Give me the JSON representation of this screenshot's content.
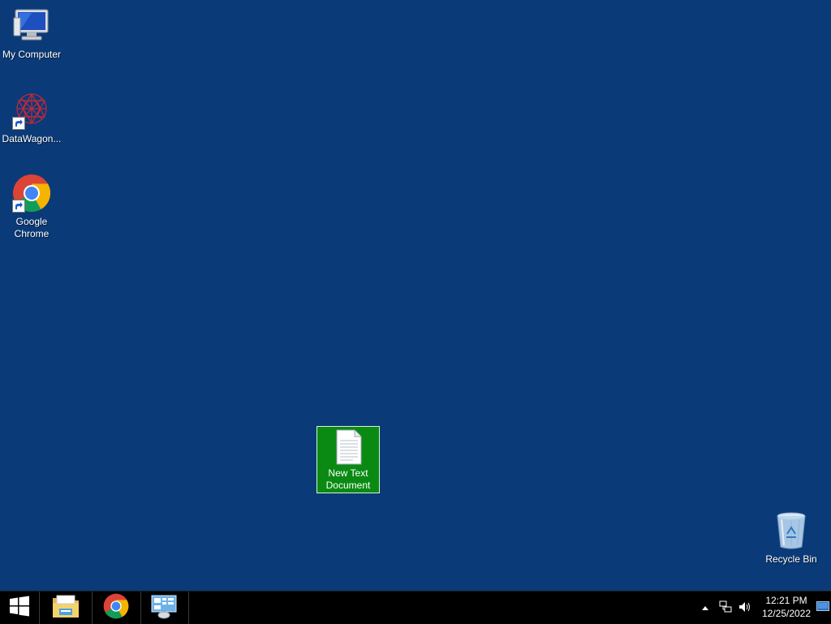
{
  "desktop": {
    "icons": [
      {
        "label": "My Computer",
        "icon": "my-computer-icon"
      },
      {
        "label": "DataWagon...",
        "icon": "datawagon-icon"
      },
      {
        "label": "Google Chrome",
        "line1": "Google",
        "line2": "Chrome",
        "icon": "chrome-icon"
      },
      {
        "label": "New Text Document",
        "line1": "New Text",
        "line2": "Document",
        "icon": "text-document-icon",
        "selected": true
      },
      {
        "label": "Recycle Bin",
        "icon": "recycle-bin-icon"
      }
    ]
  },
  "taskbar": {
    "start": {
      "icon": "windows-start-icon"
    },
    "pinned": [
      {
        "icon": "file-explorer-icon"
      },
      {
        "icon": "chrome-icon"
      },
      {
        "icon": "server-manager-icon"
      }
    ],
    "tray": {
      "icons": [
        "show-hidden-icons-chevron",
        "network-icon",
        "volume-icon"
      ],
      "time": "12:21 PM",
      "date": "12/25/2022",
      "show_desktop_icon": "show-desktop-icon"
    }
  },
  "colors": {
    "desktop_bg": "#0b3a78",
    "selection": "#0a8a12",
    "taskbar": "#000000"
  }
}
